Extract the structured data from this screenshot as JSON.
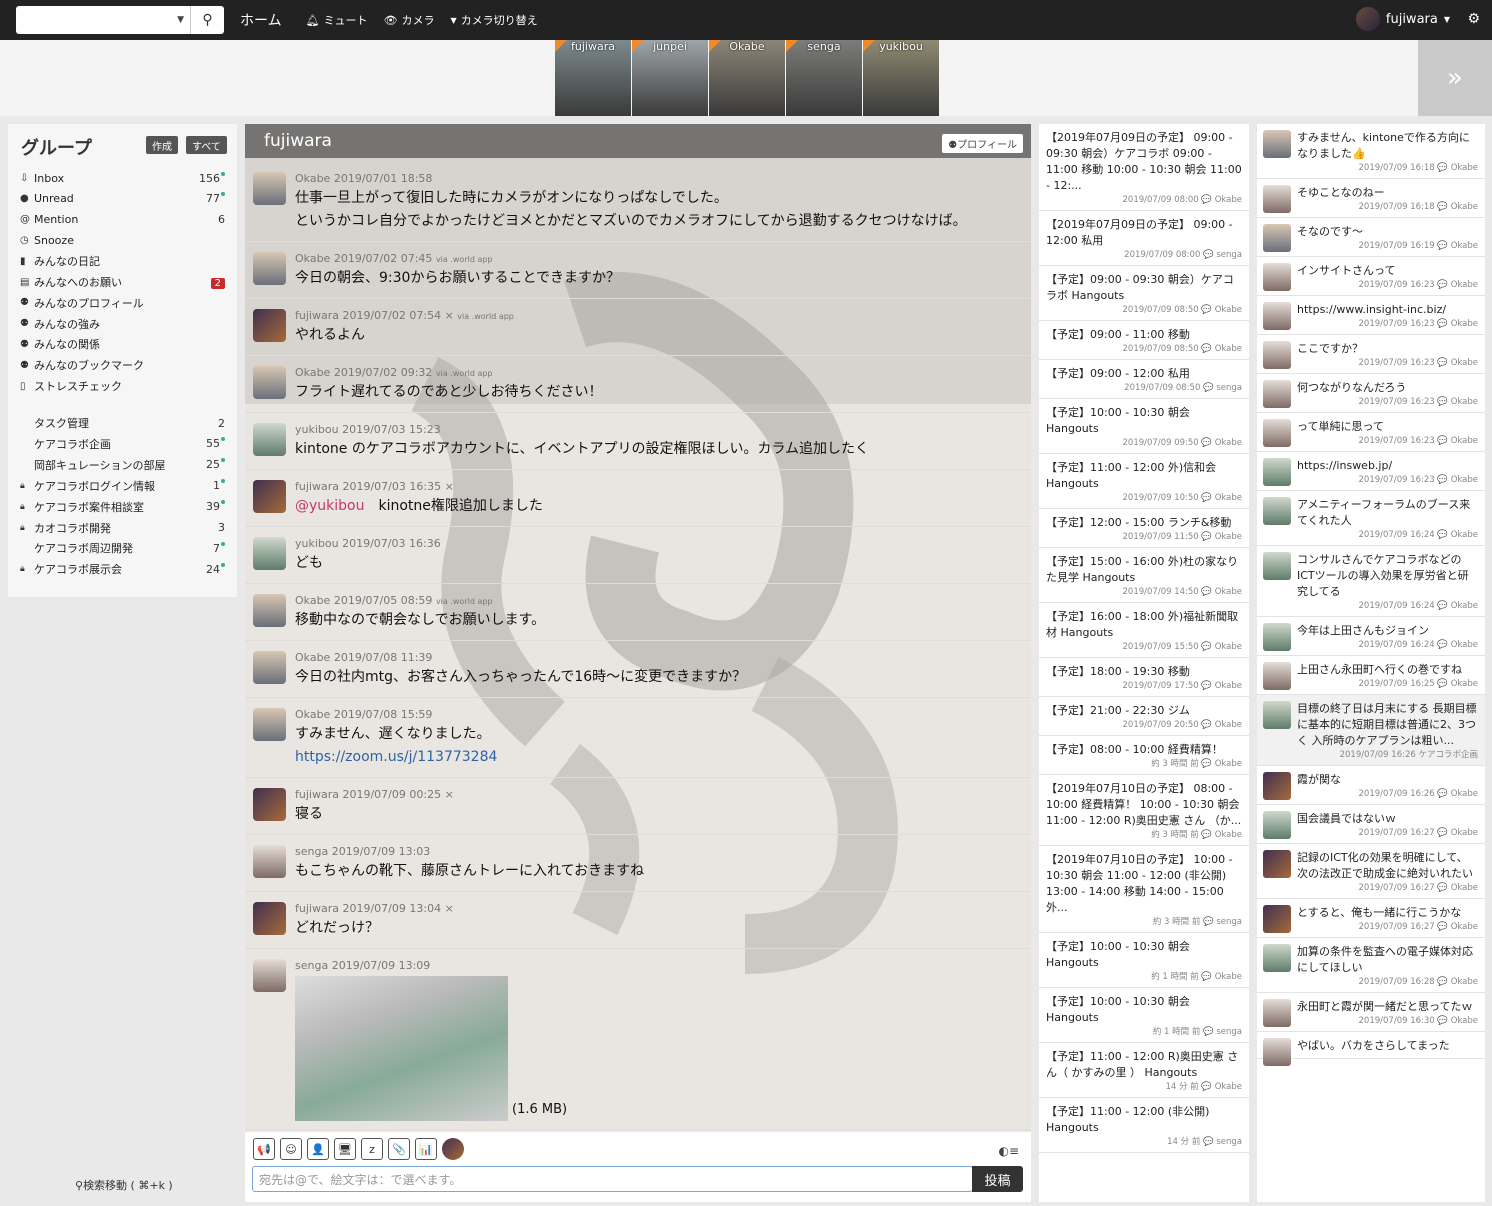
{
  "topbar": {
    "home": "ホーム",
    "mute": "ミュート",
    "camera": "カメラ",
    "camera_switch": "カメラ切り替え",
    "username": "fujiwara"
  },
  "videos": [
    {
      "name": "fujiwara",
      "active": true
    },
    {
      "name": "junpei",
      "active": false
    },
    {
      "name": "Okabe",
      "active": false
    },
    {
      "name": "senga",
      "active": false
    },
    {
      "name": "yukibou",
      "active": false
    }
  ],
  "sidebar": {
    "title": "グループ",
    "create": "作成",
    "all": "すべて",
    "items": [
      {
        "label": "Inbox",
        "count": "156",
        "icon": "⇩",
        "dot": true
      },
      {
        "label": "Unread",
        "count": "77",
        "icon": "●",
        "dot": true
      },
      {
        "label": "Mention",
        "count": "6",
        "icon": "@",
        "dot": false
      },
      {
        "label": "Snooze",
        "count": "",
        "icon": "◷",
        "dot": false
      },
      {
        "label": "みんなの日記",
        "count": "",
        "icon": "▮",
        "dot": false
      },
      {
        "label": "みんなへのお願い",
        "count": "2",
        "icon": "▤",
        "dot": false,
        "badge": true
      },
      {
        "label": "みんなのプロフィール",
        "count": "",
        "icon": "⚉",
        "dot": false
      },
      {
        "label": "みんなの強み",
        "count": "",
        "icon": "⚉",
        "dot": false
      },
      {
        "label": "みんなの関係",
        "count": "",
        "icon": "⚉",
        "dot": false
      },
      {
        "label": "みんなのブックマーク",
        "count": "",
        "icon": "⚉",
        "dot": false
      },
      {
        "label": "ストレスチェック",
        "count": "",
        "icon": "▯",
        "dot": false
      }
    ],
    "groups": [
      {
        "label": "タスク管理",
        "count": "2",
        "lock": false,
        "dot": false
      },
      {
        "label": "ケアコラボ企画",
        "count": "55",
        "lock": false,
        "dot": true
      },
      {
        "label": "岡部キュレーションの部屋",
        "count": "25",
        "lock": false,
        "dot": true
      },
      {
        "label": "ケアコラボログイン情報",
        "count": "1",
        "lock": true,
        "dot": true
      },
      {
        "label": "ケアコラボ案件相談室",
        "count": "39",
        "lock": true,
        "dot": true
      },
      {
        "label": "カオコラボ開発",
        "count": "3",
        "lock": true,
        "dot": false
      },
      {
        "label": "ケアコラボ周辺開発",
        "count": "7",
        "lock": false,
        "dot": true
      },
      {
        "label": "ケアコラボ展示会",
        "count": "24",
        "lock": true,
        "dot": true
      }
    ],
    "search_move": "検索移動 ( ⌘+k )"
  },
  "main": {
    "title": "fujiwara",
    "profile": "プロフィール",
    "messages": [
      {
        "user": "Okabe",
        "time": "2019/07/01 18:58",
        "via": "",
        "x": "",
        "av": "okabe",
        "body": [
          "仕事一旦上がって復旧した時にカメラがオンになりっぱなしでした。",
          "というかコレ自分でよかったけどヨメとかだとマズいのでカメラオフにしてから退勤するクセつけなけば。"
        ]
      },
      {
        "user": "Okabe",
        "time": "2019/07/02 07:45",
        "via": "via .world app",
        "x": "",
        "av": "okabe",
        "body": [
          "今日の朝会、9:30からお願いすることできますか？"
        ]
      },
      {
        "user": "fujiwara",
        "time": "2019/07/02 07:54",
        "via": "via .world app",
        "x": "×",
        "av": "fuji",
        "body": [
          "やれるよん"
        ]
      },
      {
        "user": "Okabe",
        "time": "2019/07/02 09:32",
        "via": "via .world app",
        "x": "",
        "av": "okabe",
        "body": [
          "フライト遅れてるのであと少しお待ちください！"
        ]
      },
      {
        "user": "yukibou",
        "time": "2019/07/03 15:23",
        "via": "",
        "x": "",
        "av": "yuki",
        "body": [
          "kintone のケアコラボアカウントに、イベントアプリの設定権限ほしい。カラム追加したく"
        ]
      },
      {
        "user": "fujiwara",
        "time": "2019/07/03 16:35",
        "via": "",
        "x": "×",
        "av": "fuji",
        "mention": "@yukibou",
        "body": [
          "kinotne権限追加しました"
        ]
      },
      {
        "user": "yukibou",
        "time": "2019/07/03 16:36",
        "via": "",
        "x": "",
        "av": "yuki",
        "body": [
          "ども"
        ]
      },
      {
        "user": "Okabe",
        "time": "2019/07/05 08:59",
        "via": "via .world app",
        "x": "",
        "av": "okabe",
        "body": [
          "移動中なので朝会なしでお願いします。"
        ]
      },
      {
        "user": "Okabe",
        "time": "2019/07/08 11:39",
        "via": "",
        "x": "",
        "av": "okabe",
        "body": [
          "今日の社内mtg、お客さん入っちゃったんで16時〜に変更できますか？"
        ]
      },
      {
        "user": "Okabe",
        "time": "2019/07/08 15:59",
        "via": "",
        "x": "",
        "av": "okabe",
        "body": [
          "すみません、遅くなりました。"
        ],
        "link": "https://zoom.us/j/113773284"
      },
      {
        "user": "fujiwara",
        "time": "2019/07/09 00:25",
        "via": "",
        "x": "×",
        "av": "fuji",
        "body": [
          "寝る"
        ]
      },
      {
        "user": "senga",
        "time": "2019/07/09 13:03",
        "via": "",
        "x": "",
        "av": "senga",
        "body": [
          "もこちゃんの靴下、藤原さんトレーに入れておきますね"
        ]
      },
      {
        "user": "fujiwara",
        "time": "2019/07/09 13:04",
        "via": "",
        "x": "×",
        "av": "fuji",
        "body": [
          "どれだっけ？"
        ]
      },
      {
        "user": "senga",
        "time": "2019/07/09 13:09",
        "via": "",
        "x": "",
        "av": "senga",
        "body": [],
        "photo": true,
        "size": "(1.6 MB)"
      }
    ]
  },
  "composer": {
    "placeholder": "宛先は@で、絵文字は：で選べます。",
    "post": "投稿",
    "tools": [
      "📢",
      "☺",
      "👤",
      "🖥",
      "z",
      "📎",
      "📊"
    ]
  },
  "schedule": [
    {
      "text": "【2019年07月09日の予定】 09:00 - 09:30 朝会）ケアコラボ 09:00 - 11:00 移動 10:00 - 10:30 朝会 11:00 - 12:...",
      "foot": "2019/07/09 08:00 💬 Okabe"
    },
    {
      "text": "【2019年07月09日の予定】 09:00 - 12:00 私用",
      "foot": "2019/07/09 08:00 💬 senga"
    },
    {
      "text": "【予定】09:00 - 09:30 朝会）ケアコラボ Hangouts",
      "foot": "2019/07/09 08:50 💬 Okabe"
    },
    {
      "text": "【予定】09:00 - 11:00 移動",
      "foot": "2019/07/09 08:50 💬 Okabe"
    },
    {
      "text": "【予定】09:00 - 12:00 私用",
      "foot": "2019/07/09 08:50 💬 senga"
    },
    {
      "text": "【予定】10:00 - 10:30 朝会 Hangouts",
      "foot": "2019/07/09 09:50 💬 Okabe"
    },
    {
      "text": "【予定】11:00 - 12:00 外)信和会 Hangouts",
      "foot": "2019/07/09 10:50 💬 Okabe"
    },
    {
      "text": "【予定】12:00 - 15:00 ランチ&移動",
      "foot": "2019/07/09 11:50 💬 Okabe"
    },
    {
      "text": "【予定】15:00 - 16:00 外)杜の家なりた見学 Hangouts",
      "foot": "2019/07/09 14:50 💬 Okabe"
    },
    {
      "text": "【予定】16:00 - 18:00 外)福祉新聞取材 Hangouts",
      "foot": "2019/07/09 15:50 💬 Okabe"
    },
    {
      "text": "【予定】18:00 - 19:30 移動",
      "foot": "2019/07/09 17:50 💬 Okabe"
    },
    {
      "text": "【予定】21:00 - 22:30 ジム",
      "foot": "2019/07/09 20:50 💬 Okabe"
    },
    {
      "text": "【予定】08:00 - 10:00 経費精算！",
      "foot": "約 3 時間 前 💬 Okabe"
    },
    {
      "text": "【2019年07月10日の予定】 08:00 - 10:00 経費精算！ 10:00 - 10:30 朝会 11:00 - 12:00 R)奥田史憲 さん （か...",
      "foot": "約 3 時間 前 💬 Okabe"
    },
    {
      "text": "【2019年07月10日の予定】 10:00 - 10:30 朝会 11:00 - 12:00 (非公開) 13:00 - 14:00 移動 14:00 - 15:00 外...",
      "foot": "約 3 時間 前 💬 senga"
    },
    {
      "text": "【予定】10:00 - 10:30 朝会 Hangouts",
      "foot": "約 1 時間 前 💬 Okabe"
    },
    {
      "text": "【予定】10:00 - 10:30 朝会 Hangouts",
      "foot": "約 1 時間 前 💬 senga"
    },
    {
      "text": "【予定】11:00 - 12:00 R)奥田史憲 さん（ かすみの里 ） Hangouts",
      "foot": "14 分 前 💬 Okabe"
    },
    {
      "text": "【予定】11:00 - 12:00 (非公開) Hangouts",
      "foot": "14 分 前 💬 senga"
    }
  ],
  "feed": [
    {
      "text": "すみません、kintoneで作る方向になりました👍",
      "foot": "2019/07/09 16:18 💬 Okabe",
      "av": "okabe"
    },
    {
      "text": "そゆことなのねー",
      "foot": "2019/07/09 16:18 💬 Okabe",
      "av": "senga"
    },
    {
      "text": "そなのです〜",
      "foot": "2019/07/09 16:19 💬 Okabe",
      "av": "okabe"
    },
    {
      "text": "インサイトさんって",
      "foot": "2019/07/09 16:23 💬 Okabe",
      "av": "senga"
    },
    {
      "text": "https://www.insight-inc.biz/",
      "foot": "2019/07/09 16:23 💬 Okabe",
      "av": "senga"
    },
    {
      "text": "ここですか？",
      "foot": "2019/07/09 16:23 💬 Okabe",
      "av": "senga"
    },
    {
      "text": "何つながりなんだろう",
      "foot": "2019/07/09 16:23 💬 Okabe",
      "av": "senga"
    },
    {
      "text": "って単純に思って",
      "foot": "2019/07/09 16:23 💬 Okabe",
      "av": "senga"
    },
    {
      "text": "https://insweb.jp/",
      "foot": "2019/07/09 16:23 💬 Okabe",
      "av": "yuki"
    },
    {
      "text": "アメニティーフォーラムのブース来てくれた人",
      "foot": "2019/07/09 16:24 💬 Okabe",
      "av": "yuki"
    },
    {
      "text": "コンサルさんでケアコラボなどのICTツールの導入効果を厚労省と研究してる",
      "foot": "2019/07/09 16:24 💬 Okabe",
      "av": "yuki"
    },
    {
      "text": "今年は上田さんもジョイン",
      "foot": "2019/07/09 16:24 💬 Okabe",
      "av": "yuki"
    },
    {
      "text": "上田さん永田町へ行くの巻ですね",
      "foot": "2019/07/09 16:25 💬 Okabe",
      "av": "senga"
    },
    {
      "text": "目標の終了日は月末にする 長期目標に基本的に短期目標は普通に2、3つく 入所時のケアプランは粗い...",
      "foot": "2019/07/09 16:26 ケアコラボ企画",
      "av": "yuki",
      "hl": true
    },
    {
      "text": "霞が関な",
      "foot": "2019/07/09 16:26 💬 Okabe",
      "av": "fuji"
    },
    {
      "text": "国会議員ではないｗ",
      "foot": "2019/07/09 16:27 💬 Okabe",
      "av": "yuki"
    },
    {
      "text": "記録のICT化の効果を明確にして、次の法改正で助成金に絶対いれたい",
      "foot": "2019/07/09 16:27 💬 Okabe",
      "av": "fuji"
    },
    {
      "text": "とすると、俺も一緒に行こうかな",
      "foot": "2019/07/09 16:27 💬 Okabe",
      "av": "fuji"
    },
    {
      "text": "加算の条件を監査への電子媒体対応にしてほしい",
      "foot": "2019/07/09 16:28 💬 Okabe",
      "av": "yuki"
    },
    {
      "text": "永田町と霞が関一緒だと思ってたｗ",
      "foot": "2019/07/09 16:30 💬 Okabe",
      "av": "senga"
    },
    {
      "text": "やばい。バカをさらしてまった",
      "foot": "",
      "av": "senga"
    }
  ]
}
